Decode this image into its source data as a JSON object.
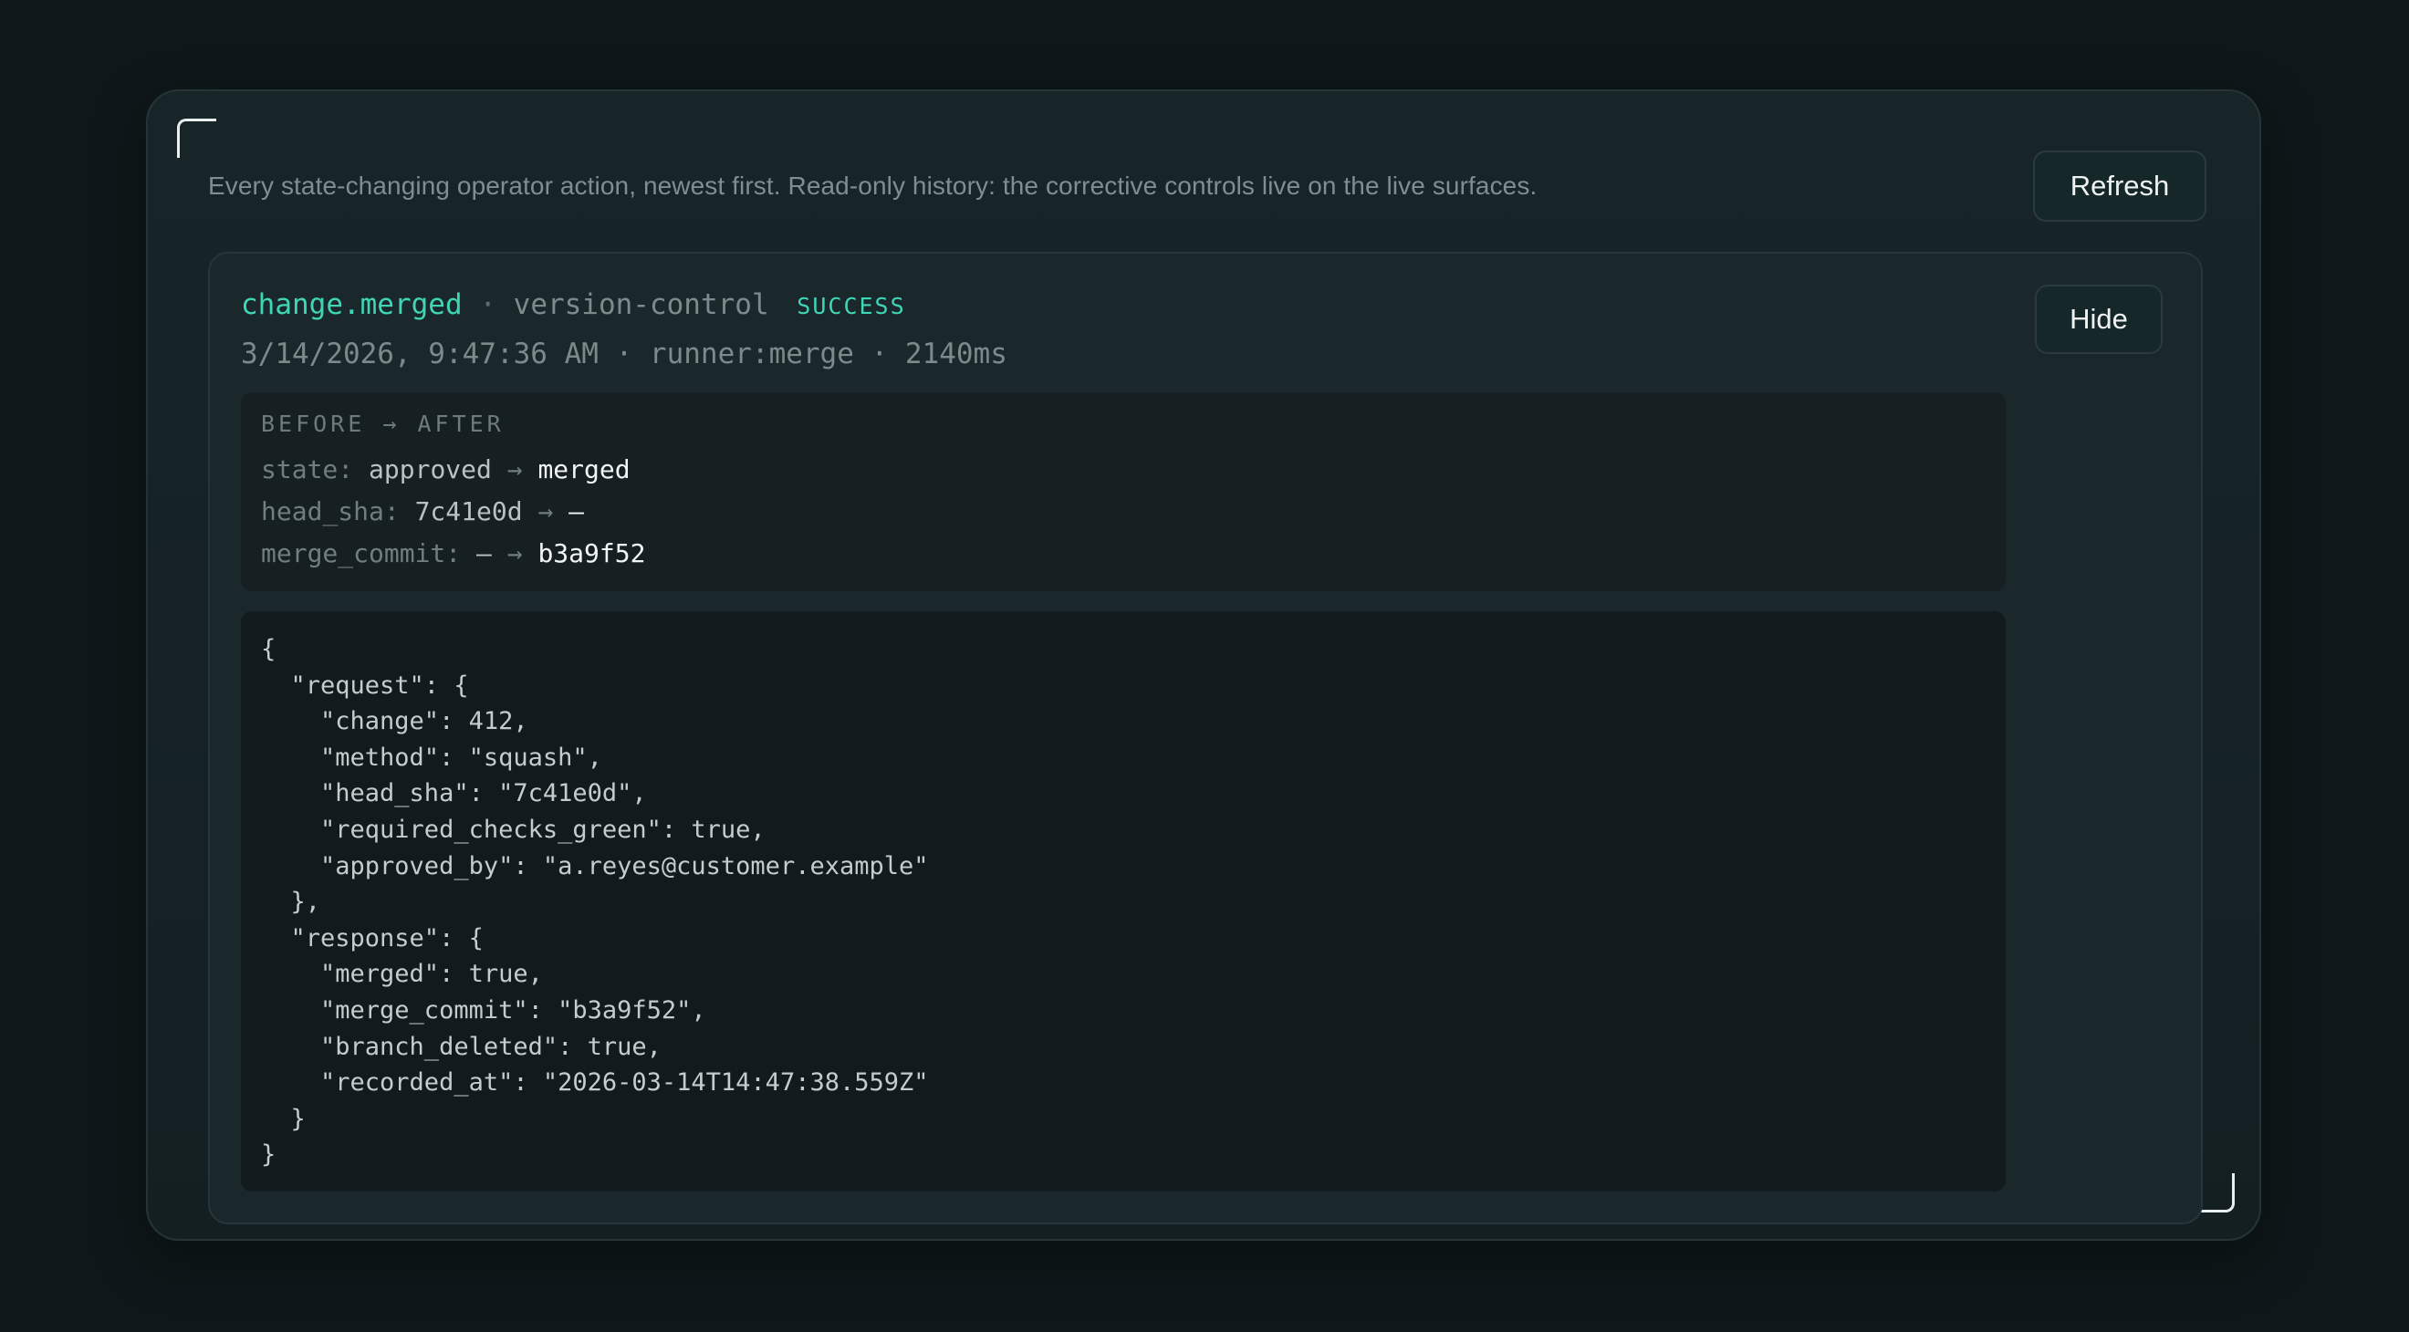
{
  "header": {
    "description": "Every state-changing operator action, newest first. Read-only history: the corrective controls live on the live surfaces.",
    "refresh_label": "Refresh"
  },
  "entry": {
    "event": "change.merged",
    "dot": "·",
    "source": "version-control",
    "status": "SUCCESS",
    "meta": "3/14/2026, 9:47:36 AM · runner:merge · 2140ms",
    "hide_label": "Hide",
    "diff": {
      "title": "BEFORE → AFTER",
      "arrow": "→",
      "rows": [
        {
          "key": "state:",
          "before": "approved",
          "after": "merged"
        },
        {
          "key": "head_sha:",
          "before": "7c41e0d",
          "after": "—"
        },
        {
          "key": "merge_commit:",
          "before": "—",
          "after": "b3a9f52"
        }
      ]
    },
    "payload": "{\n  \"request\": {\n    \"change\": 412,\n    \"method\": \"squash\",\n    \"head_sha\": \"7c41e0d\",\n    \"required_checks_green\": true,\n    \"approved_by\": \"a.reyes@customer.example\"\n  },\n  \"response\": {\n    \"merged\": true,\n    \"merge_commit\": \"b3a9f52\",\n    \"branch_deleted\": true,\n    \"recorded_at\": \"2026-03-14T14:47:38.559Z\"\n  }\n}"
  },
  "colors": {
    "accent": "#3fd6b6",
    "background": "#0e1719",
    "panel": "#172529"
  }
}
